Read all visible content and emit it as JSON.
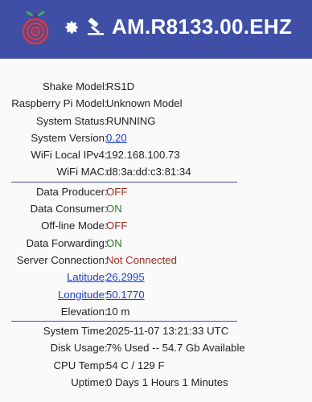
{
  "header": {
    "station": "AM.R8133.00.EHZ"
  },
  "group1": [
    {
      "label": "Shake Model",
      "value": "RS1D"
    },
    {
      "label": "Raspberry Pi Model",
      "value": "Unknown Model"
    },
    {
      "label": "System Status",
      "value": "RUNNING"
    },
    {
      "label": "System Version",
      "value": "0.20"
    },
    {
      "label": "WiFi Local IPv4",
      "value": "192.168.100.73"
    },
    {
      "label": "WiFi MAC",
      "value": "d8:3a:dd:c3:81:34"
    }
  ],
  "group2": [
    {
      "label": "Data Producer",
      "value": "OFF"
    },
    {
      "label": "Data Consumer",
      "value": "ON"
    },
    {
      "label": "Off-line Mode",
      "value": "OFF"
    },
    {
      "label": "Data Forwarding",
      "value": "ON"
    },
    {
      "label": "Server Connection",
      "value": "Not Connected"
    },
    {
      "label": "Latitude",
      "value": "26.2995"
    },
    {
      "label": "Longitude",
      "value": "50.1770"
    },
    {
      "label": "Elevation",
      "value": "10 m"
    }
  ],
  "group3": [
    {
      "label": "System Time",
      "value": "2025-11-07 13:21:33 UTC"
    },
    {
      "label": "Disk Usage",
      "value": "7% Used -- 54.7 Gb Available"
    },
    {
      "label": "CPU Temp",
      "value": "54 C / 129 F"
    },
    {
      "label": "Uptime",
      "value": "0 Days 1 Hours 1 Minutes"
    }
  ],
  "colors": {
    "header": "#3f4fa6",
    "link": "#1a3fcc",
    "off": "#9a2a1a",
    "on": "#2a7a2a"
  },
  "icons": [
    "raspberry-shake-logo-icon",
    "gear-icon",
    "hammer-icon"
  ]
}
